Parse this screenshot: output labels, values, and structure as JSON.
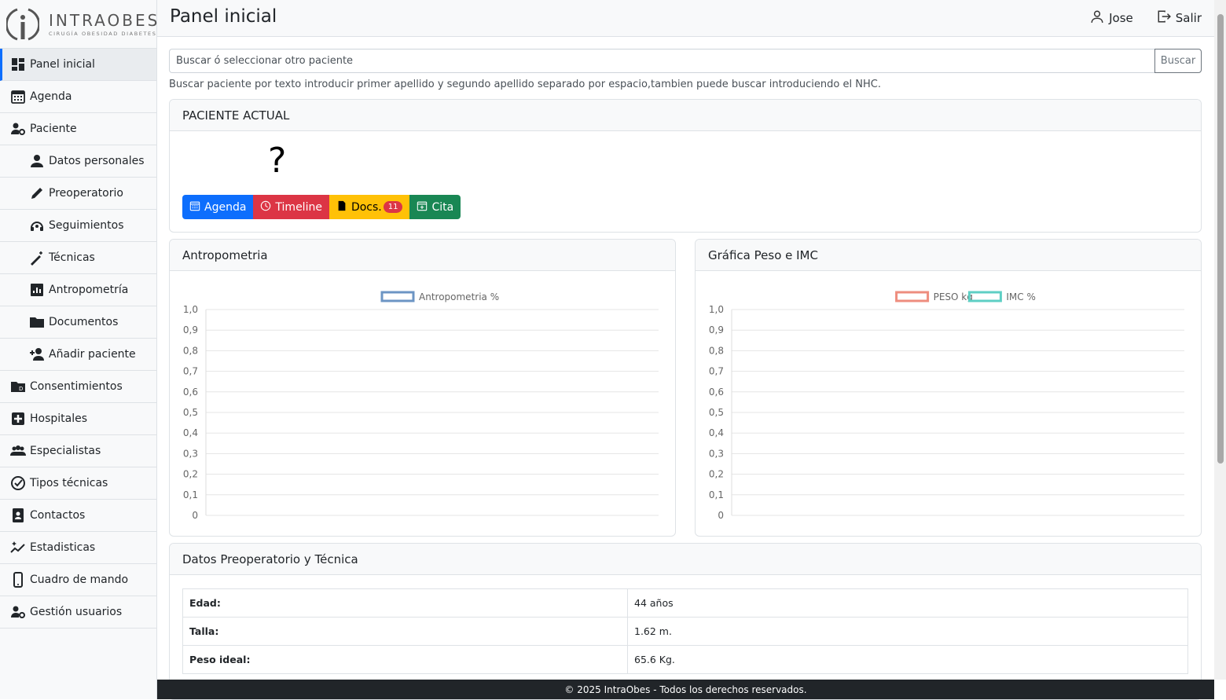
{
  "brand": {
    "name": "INTRAOBES",
    "tagline": "CIRUGÍA OBESIDAD DIABETES"
  },
  "sidebar": {
    "items": [
      {
        "label": "Panel inicial",
        "icon": "dashboard-icon",
        "active": true,
        "sub": false
      },
      {
        "label": "Agenda",
        "icon": "calendar-icon",
        "sub": false
      },
      {
        "label": "Paciente",
        "icon": "user-gear-icon",
        "sub": false
      },
      {
        "label": "Datos personales",
        "icon": "person-icon",
        "sub": true
      },
      {
        "label": "Preoperatorio",
        "icon": "pencil-icon",
        "sub": true
      },
      {
        "label": "Seguimientos",
        "icon": "headset-icon",
        "sub": true
      },
      {
        "label": "Técnicas",
        "icon": "wand-icon",
        "sub": true
      },
      {
        "label": "Antropometría",
        "icon": "analytics-icon",
        "sub": true
      },
      {
        "label": "Documentos",
        "icon": "folder-icon",
        "sub": true
      },
      {
        "label": "Añadir paciente",
        "icon": "person-add-icon",
        "sub": true
      },
      {
        "label": "Consentimientos",
        "icon": "folder-doc-icon",
        "sub": false
      },
      {
        "label": "Hospitales",
        "icon": "plus-box-icon",
        "sub": false
      },
      {
        "label": "Especialistas",
        "icon": "group-icon",
        "sub": false
      },
      {
        "label": "Tipos técnicas",
        "icon": "check-circle-icon",
        "sub": false
      },
      {
        "label": "Contactos",
        "icon": "contacts-icon",
        "sub": false
      },
      {
        "label": "Estadisticas",
        "icon": "sparkle-chart-icon",
        "sub": false
      },
      {
        "label": "Cuadro de mando",
        "icon": "phone-icon",
        "sub": false
      },
      {
        "label": "Gestión usuarios",
        "icon": "user-gear-icon",
        "sub": false
      }
    ]
  },
  "header": {
    "title": "Panel inicial",
    "user": "Jose",
    "logout": "Salir"
  },
  "search": {
    "placeholder": "Buscar ó seleccionar otro paciente",
    "button": "Buscar",
    "help": "Buscar paciente por texto introducir primer apellido y segundo apellido separado por espacio,tambien puede buscar introduciendo el NHC."
  },
  "patient_card": {
    "title": "PACIENTE ACTUAL",
    "avatar_placeholder": "?",
    "buttons": {
      "agenda": "Agenda",
      "timeline": "Timeline",
      "docs": "Docs.",
      "docs_count": "11",
      "cita": "Cita"
    }
  },
  "charts_titles": {
    "antropometria": "Antropometria",
    "peso_imc": "Gráfica Peso e IMC"
  },
  "chart_data": [
    {
      "type": "line",
      "series": [
        {
          "name": "Antropometria %",
          "color": "#6c95c4",
          "values": []
        }
      ],
      "x": [],
      "ylim": [
        0,
        1
      ],
      "yticks": [
        "0",
        "0,1",
        "0,2",
        "0,3",
        "0,4",
        "0,5",
        "0,6",
        "0,7",
        "0,8",
        "0,9",
        "1,0"
      ],
      "grid": true,
      "legend": "top"
    },
    {
      "type": "line",
      "series": [
        {
          "name": "PESO kg",
          "color": "#ee8d7e",
          "values": []
        },
        {
          "name": "IMC %",
          "color": "#5ecfc4",
          "values": []
        }
      ],
      "x": [],
      "ylim": [
        0,
        1
      ],
      "yticks": [
        "0",
        "0,1",
        "0,2",
        "0,3",
        "0,4",
        "0,5",
        "0,6",
        "0,7",
        "0,8",
        "0,9",
        "1,0"
      ],
      "grid": true,
      "legend": "top"
    }
  ],
  "preop": {
    "title": "Datos Preoperatorio y Técnica",
    "rows": [
      {
        "label": "Edad:",
        "value": "44 años"
      },
      {
        "label": "Talla:",
        "value": "1.62 m."
      },
      {
        "label": "Peso ideal:",
        "value": "65.6 Kg."
      }
    ]
  },
  "footer": "© 2025 IntraObes - Todos los derechos reservados."
}
